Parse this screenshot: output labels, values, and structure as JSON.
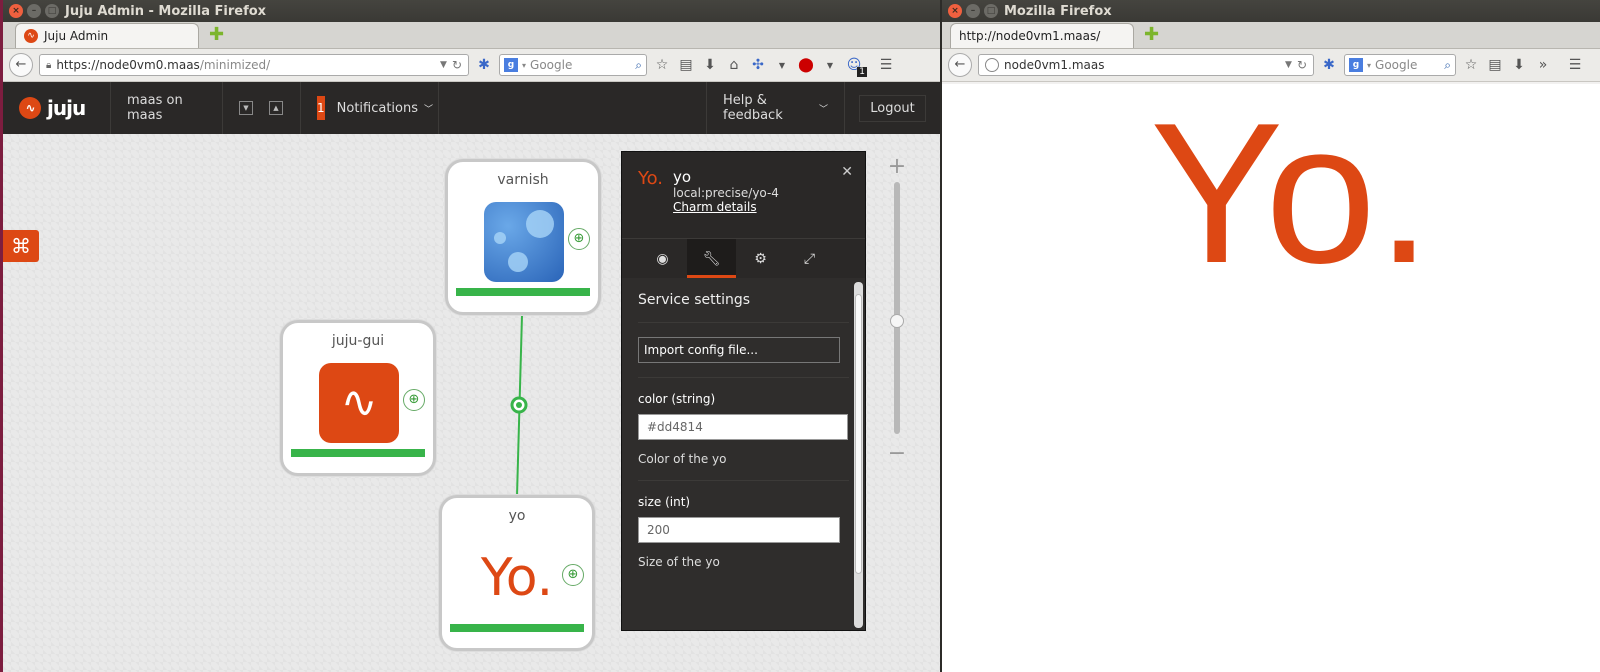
{
  "left_window": {
    "title": "Juju Admin - Mozilla Firefox",
    "tab_label": "Juju Admin",
    "url_host": "https://node0vm0.maas",
    "url_path": "/minimized/",
    "search_placeholder": "Google",
    "addon_badge": "1"
  },
  "juju_header": {
    "logo_text": "juju",
    "environment": "maas on maas",
    "notif_count": "1",
    "notifications_label": "Notifications",
    "help_label": "Help & feedback",
    "logout_label": "Logout"
  },
  "services": [
    {
      "name": "varnish",
      "icon": "varnish-icon"
    },
    {
      "name": "juju-gui",
      "icon": "juju-gui-icon"
    },
    {
      "name": "yo",
      "icon_text": "Yo."
    }
  ],
  "inspector": {
    "logo": "Yo.",
    "name": "yo",
    "charm": "local:precise/yo-4",
    "charm_link": "Charm details",
    "section_title": "Service settings",
    "import_label": "Import config file...",
    "fields": [
      {
        "label": "color (string)",
        "value": "#dd4814",
        "help": "Color of the yo"
      },
      {
        "label": "size (int)",
        "value": "200",
        "help": "Size of the yo"
      }
    ]
  },
  "right_window": {
    "title": "Mozilla Firefox",
    "tab_label": "http://node0vm1.maas/",
    "url": "node0vm1.maas",
    "search_placeholder": "Google",
    "page_text": "Yo."
  },
  "colors": {
    "accent": "#dd4814",
    "status_ok": "#38b44a",
    "header_dark": "#2a2827"
  }
}
